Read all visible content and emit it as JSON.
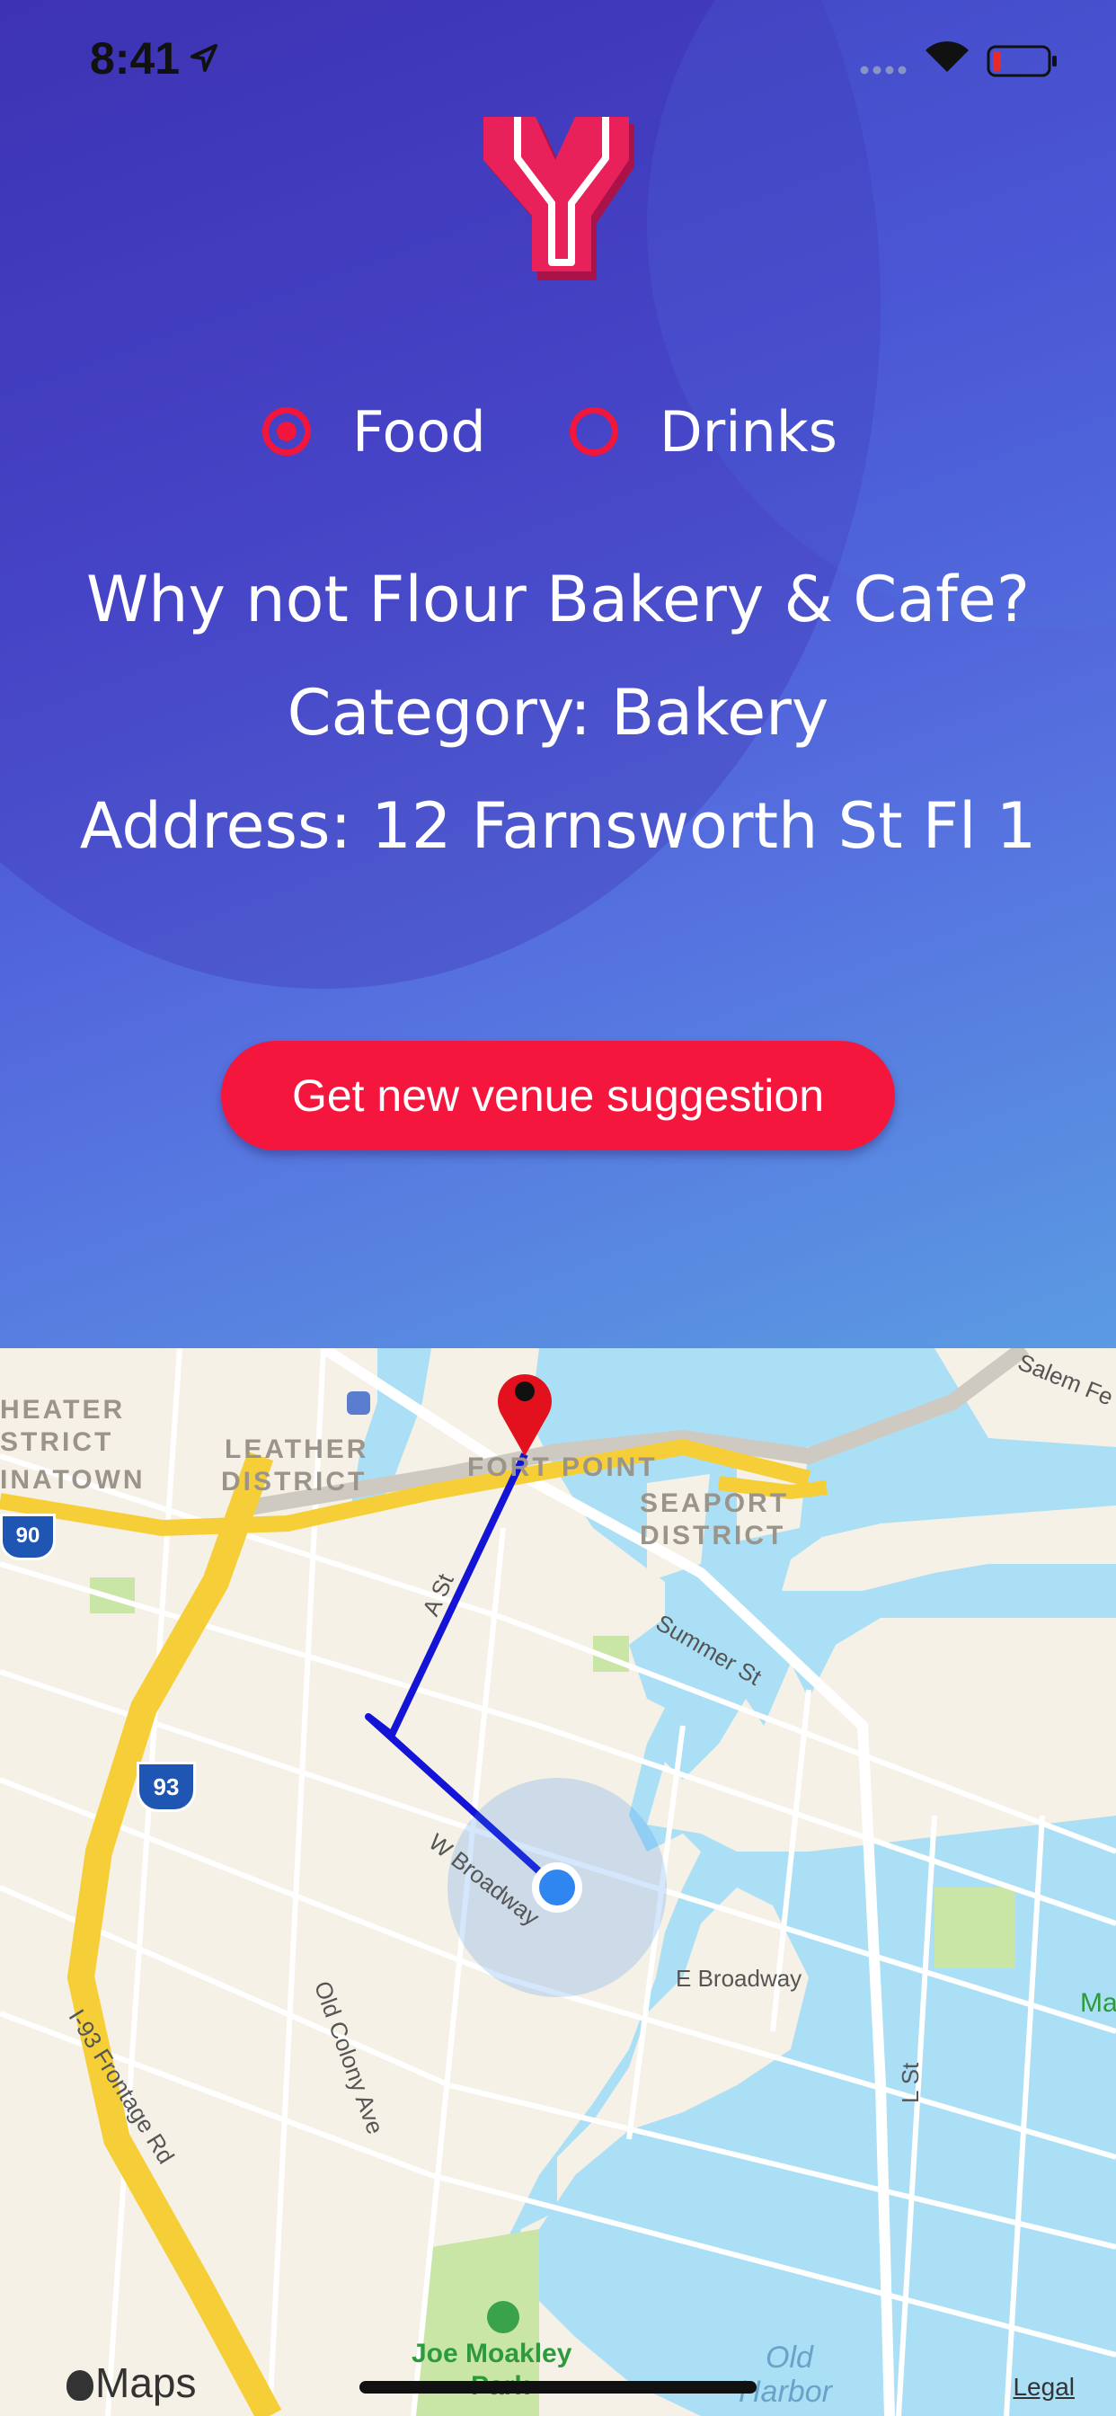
{
  "status_bar": {
    "time": "8:41",
    "icons": [
      "location-arrow-icon",
      "cellular-signal-icon",
      "wifi-icon",
      "battery-low-icon"
    ]
  },
  "logo": {
    "name": "y-logo",
    "color": "#e8215a"
  },
  "venue_type": {
    "options": [
      {
        "label": "Food",
        "selected": true
      },
      {
        "label": "Drinks",
        "selected": false
      }
    ]
  },
  "suggestion": {
    "headline": "Why not Flour Bakery & Cafe?",
    "category": "Category: Bakery",
    "address": "Address: 12 Farnsworth St Fl 1"
  },
  "actions": {
    "new_suggestion_label": "Get new venue suggestion"
  },
  "map": {
    "districts": [
      "HEATER",
      "STRICT",
      "INATOWN",
      "LEATHER",
      "DISTRICT",
      "FORT POINT",
      "SEAPORT",
      "DISTRICT"
    ],
    "streets": [
      "Summer St",
      "A St",
      "W Broadway",
      "E Broadway",
      "Old Colony Ave",
      "I-93 Frontage Rd",
      "L St",
      "Salem Fe"
    ],
    "highway_shields": [
      "90",
      "93"
    ],
    "park": "Joe Moakley",
    "park_line2": "Park",
    "water": "Old",
    "water_line2": "Harbor",
    "edge_label": "Ma",
    "provider": "Maps",
    "legal": "Legal"
  },
  "colors": {
    "accent": "#f5163e",
    "route": "#1414d6",
    "user_location": "#2f86f0",
    "pin": "#e3101d",
    "water": "#aadff5",
    "highway": "#f6cf38",
    "park": "#c9e6a6"
  }
}
